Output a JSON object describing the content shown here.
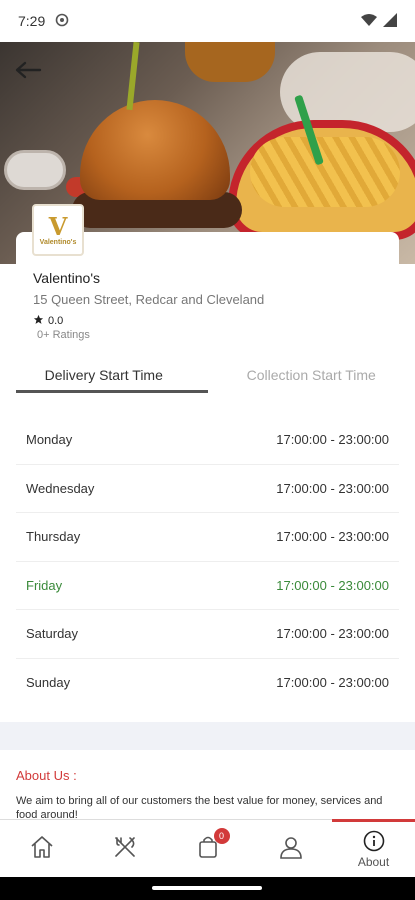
{
  "status_bar": {
    "time": "7:29"
  },
  "restaurant": {
    "logo_letter": "V",
    "logo_text": "Valentino's",
    "name": "Valentino's",
    "address": "15 Queen Street, Redcar and Cleveland",
    "rating": "0.0",
    "ratings_count": "0+ Ratings"
  },
  "tabs": [
    {
      "label": "Delivery Start Time",
      "active": true
    },
    {
      "label": "Collection Start Time",
      "active": false
    }
  ],
  "hours": [
    {
      "day": "Monday",
      "time": "17:00:00 - 23:00:00"
    },
    {
      "day": "Wednesday",
      "time": "17:00:00 - 23:00:00"
    },
    {
      "day": "Thursday",
      "time": "17:00:00 - 23:00:00"
    },
    {
      "day": "Friday",
      "time": "17:00:00 - 23:00:00",
      "today": true
    },
    {
      "day": "Saturday",
      "time": "17:00:00 - 23:00:00"
    },
    {
      "day": "Sunday",
      "time": "17:00:00 - 23:00:00"
    }
  ],
  "about": {
    "title": "About Us :",
    "text": "We aim to bring all of our customers the best value for money, services and food around!"
  },
  "bottom_nav": {
    "cart_badge": "0",
    "about_label": "About"
  },
  "colors": {
    "accent": "#d23a3a",
    "today": "#3a8a3a"
  }
}
